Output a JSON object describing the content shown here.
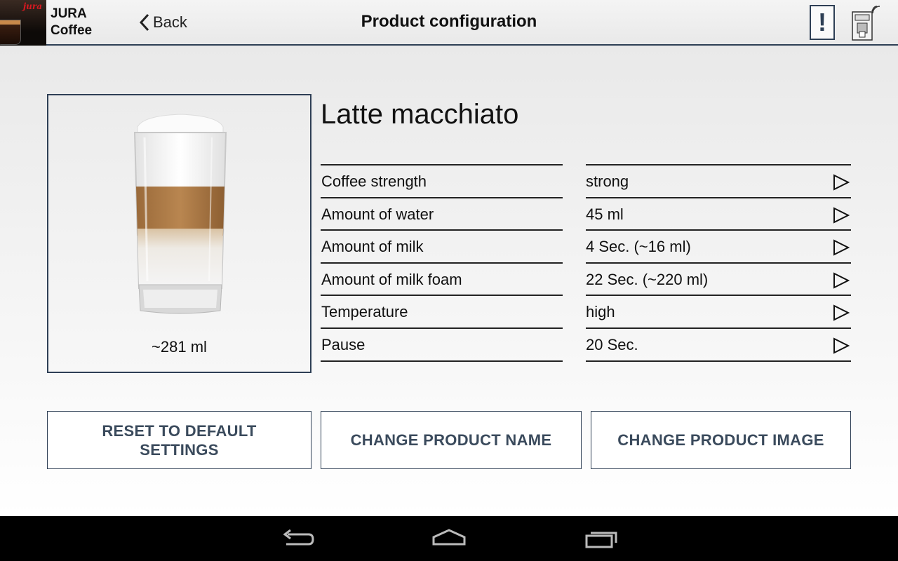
{
  "header": {
    "brand_logo_text": "jura",
    "app_name_line1": "JURA",
    "app_name_line2": "Coffee",
    "back_label": "Back",
    "title": "Product configuration",
    "alert_label": "!"
  },
  "product": {
    "name": "Latte macchiato",
    "volume": "~281 ml",
    "image_icon": "latte-macchiato-glass"
  },
  "settings": [
    {
      "label": "Coffee strength",
      "value": "strong"
    },
    {
      "label": "Amount of water",
      "value": "45 ml"
    },
    {
      "label": "Amount of milk",
      "value": "4 Sec. (~16 ml)"
    },
    {
      "label": "Amount of milk foam",
      "value": "22 Sec. (~220 ml)"
    },
    {
      "label": "Temperature",
      "value": "high"
    },
    {
      "label": "Pause",
      "value": "20 Sec."
    }
  ],
  "actions": {
    "reset_line1": "RESET TO DEFAULT",
    "reset_line2": "SETTINGS",
    "change_name": "CHANGE PRODUCT NAME",
    "change_image": "CHANGE PRODUCT IMAGE"
  },
  "navbar": {
    "icons": [
      "back-icon",
      "home-icon",
      "recent-apps-icon"
    ]
  },
  "colors": {
    "accent": "#2e3f55",
    "button_text": "#3a4a5c",
    "brand_red": "#d71920"
  }
}
